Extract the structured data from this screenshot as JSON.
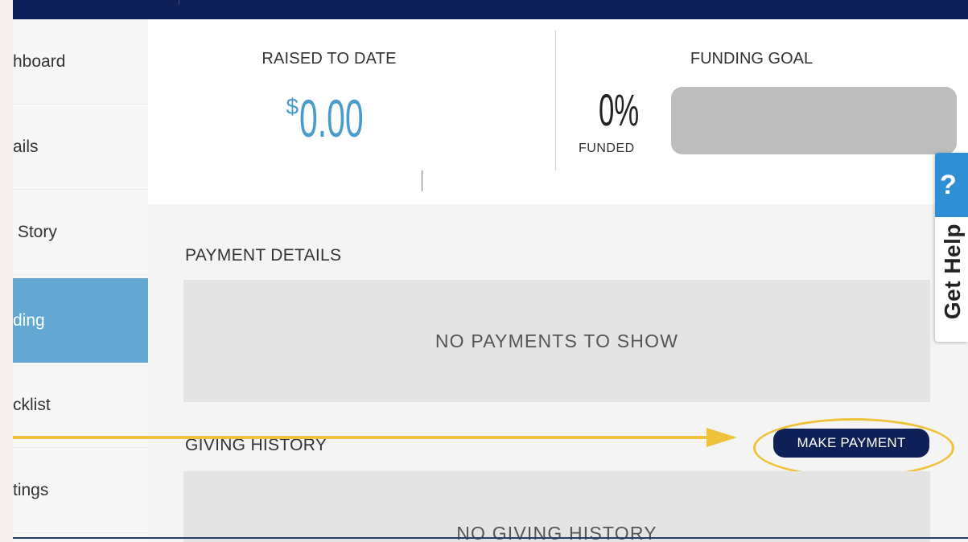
{
  "sidebar": {
    "items": [
      {
        "label": "hboard",
        "active": false
      },
      {
        "label": "ails",
        "active": false
      },
      {
        "label": " Story",
        "active": false
      },
      {
        "label": "ding",
        "active": true
      },
      {
        "label": "cklist",
        "active": false
      },
      {
        "label": "tings",
        "active": false
      }
    ]
  },
  "summary": {
    "raised_label": "RAISED TO DATE",
    "raised_currency": "$",
    "raised_amount": "0.00",
    "goal_label": "FUNDING GOAL",
    "percent_text": "0%",
    "funded_label": "FUNDED",
    "progress_fraction": 0
  },
  "payment_details": {
    "title": "PAYMENT DETAILS",
    "empty_text": "NO PAYMENTS TO SHOW"
  },
  "giving_history": {
    "title": "GIVING HISTORY",
    "empty_text": "NO GIVING HISTORY",
    "make_payment_label": "MAKE PAYMENT"
  },
  "help": {
    "icon_text": "?",
    "label": "Get Help"
  },
  "colors": {
    "navy": "#0f1f57",
    "accent_blue": "#62a8d3",
    "amount_blue": "#4a9ccc",
    "highlight_yellow": "#efc23b",
    "help_blue": "#2f8fd4"
  },
  "icons": {
    "help": "question-mark-icon",
    "annotation_arrow": "arrow-right-icon"
  }
}
